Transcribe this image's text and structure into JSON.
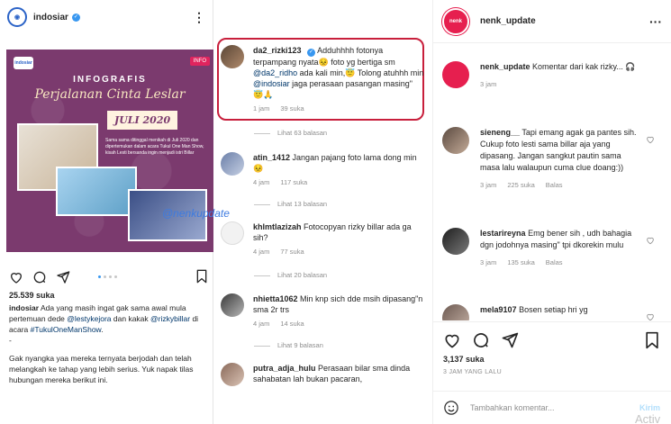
{
  "left_post": {
    "username": "indosiar",
    "logo_text": "indosiar",
    "poster": {
      "badge": "INFOGRAFIS",
      "title1": "INFOGRAFIS",
      "title2": "Perjalanan Cinta Leslar",
      "date": "JULI 2020",
      "caption": "Sama sama ditinggal menikah di Juli 2020 dan dipertemukan dalam acara Tukul One Man Show, kisah Lesti bersanda ingin menjadi istri Billar",
      "watermark": "@nenkupdate"
    },
    "likes": "25.539 suka",
    "caption_user": "indosiar",
    "caption_p1": "Ada yang masih ingat gak sama awal mula pertemuan dede ",
    "tag1": "@lestykejora",
    "caption_mid": " dan kakak ",
    "tag2": "@rizkybillar",
    "caption_p1b": " di acara ",
    "tag3": "#TukulOneManShow",
    "caption_p1c": ".",
    "caption_dot": "-",
    "caption_p2": "Gak nyangka yaa mereka ternyata berjodah dan telah melangkah ke tahap yang lebih serius. Yuk napak tilas hubungan mereka berikut ini."
  },
  "mid_comments": [
    {
      "user": "da2_rizki123",
      "text_a": "Adduhhhh fotonya terpampang nyata😣 foto yg bertiga sm ",
      "tag_a": "@da2_ridho",
      "text_b": " ada kali min,😇 Tolong atuhhh min ",
      "tag_b": "@indosiar",
      "text_c": " jaga perasaan pasangan masing\" 😇🙏",
      "time": "1 jam",
      "likes": "39 suka"
    },
    {
      "user": "atin_1412",
      "text": "Jangan pajang foto lama dong min😣",
      "time": "4 jam",
      "likes": "117 suka"
    },
    {
      "user": "khlmtlazizah",
      "text": "Fotocopyan rizky billar ada ga sih?",
      "time": "4 jam",
      "likes": "77 suka"
    },
    {
      "user": "nhietta1062",
      "text": "Min knp sich dde msih dipasang\"n sma 2r trs",
      "time": "4 jam",
      "likes": "14 suka"
    },
    {
      "user": "putra_adja_hulu",
      "text": "Perasaan bilar sma dinda sahabatan lah bukan pacaran,",
      "time": "",
      "likes": ""
    }
  ],
  "replies": [
    "Lihat 63 balasan",
    "Lihat 13 balasan",
    "Lihat 20 balasan",
    "Lihat 9 balasan"
  ],
  "right": {
    "username": "nenk_update",
    "avatar_text": "nenk_update",
    "owner_comment": "Komentar dari kak rizky... 🎧",
    "owner_time": "3 jam",
    "comments": [
      {
        "user": "sieneng__",
        "text": "Tapi emang agak ga pantes sih. Cukup foto lesti sama billar aja yang dipasang. Jangan sangkut pautin sama masa lalu walaupun cuma clue doang:))",
        "time": "3 jam",
        "likes": "225 suka",
        "reply": "Balas"
      },
      {
        "user": "lestarireyna",
        "text": "Emg bener sih , udh bahagia dgn jodohnya masing\" tpi dkorekin mulu",
        "time": "3 jam",
        "likes": "135 suka",
        "reply": "Balas"
      },
      {
        "user": "mela9107",
        "text": "Bosen setiap hri yg",
        "time": "",
        "likes": "",
        "reply": ""
      }
    ],
    "likes": "3,137 suka",
    "time_ago": "3 JAM YANG LALU",
    "comment_placeholder": "Tambahkan komentar...",
    "post_button": "Kirim",
    "activate_text": "Activ"
  }
}
